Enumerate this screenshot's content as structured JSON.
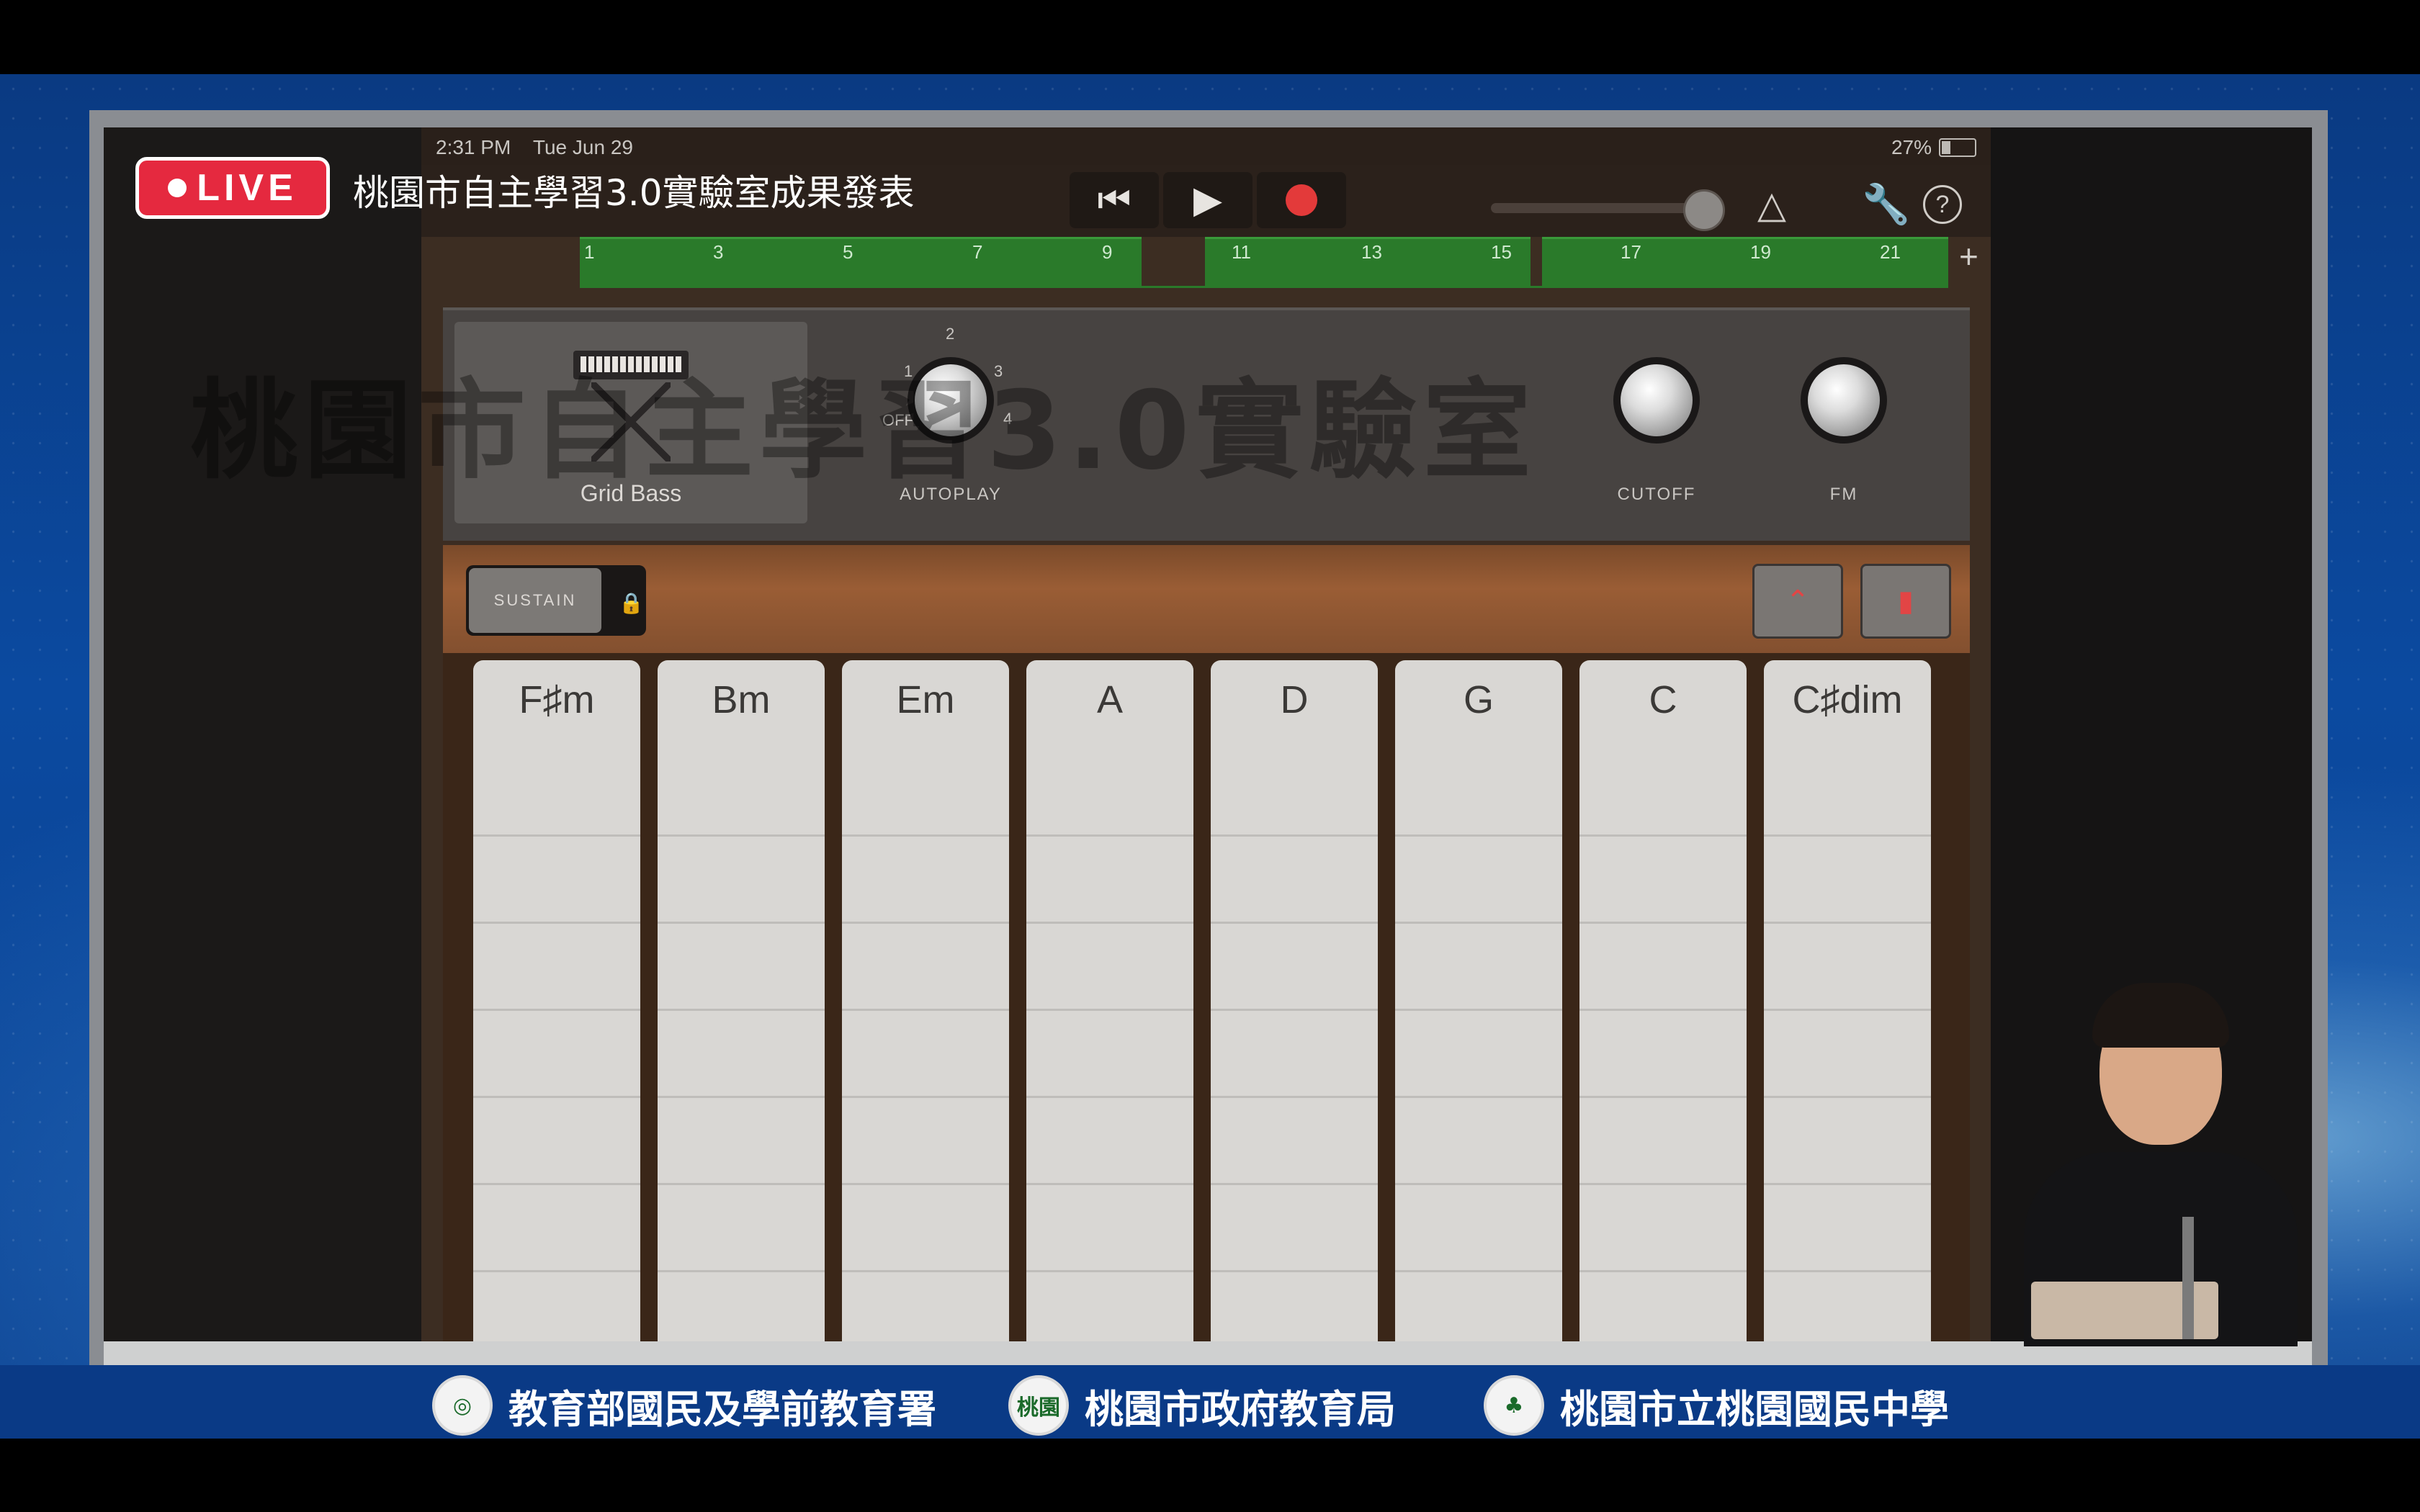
{
  "live": {
    "badge": "LIVE",
    "title": "桃園市自主學習3.0實驗室成果發表"
  },
  "watermark": "桃園市自主學習3.0實驗室",
  "statusbar": {
    "time": "2:31 PM",
    "date": "Tue Jun 29",
    "battery": "27%"
  },
  "toolbar": {
    "rewind_icon": "rewind-icon",
    "play_icon": "play-icon",
    "record_icon": "record-icon",
    "metronome_icon": "metronome-icon",
    "settings_icon": "wrench-icon",
    "help_label": "?"
  },
  "ruler": {
    "numbers": [
      "1",
      "3",
      "5",
      "7",
      "9",
      "11",
      "13",
      "15",
      "17",
      "19",
      "21"
    ],
    "add": "+"
  },
  "instrument": {
    "name": "Grid Bass",
    "autoplay": {
      "label": "AUTOPLAY",
      "marks": [
        "OFF",
        "1",
        "2",
        "3",
        "4"
      ]
    },
    "cutoff_label": "CUTOFF",
    "fm_label": "FM"
  },
  "controls": {
    "sustain_label": "SUSTAIN"
  },
  "chords": [
    "F♯m",
    "Bm",
    "Em",
    "A",
    "D",
    "G",
    "C",
    "C♯dim"
  ],
  "sponsors": [
    "教育部國民及學前教育署",
    "桃園市政府教育局",
    "桃園市立桃園國民中學"
  ],
  "seal_text": "桃園"
}
